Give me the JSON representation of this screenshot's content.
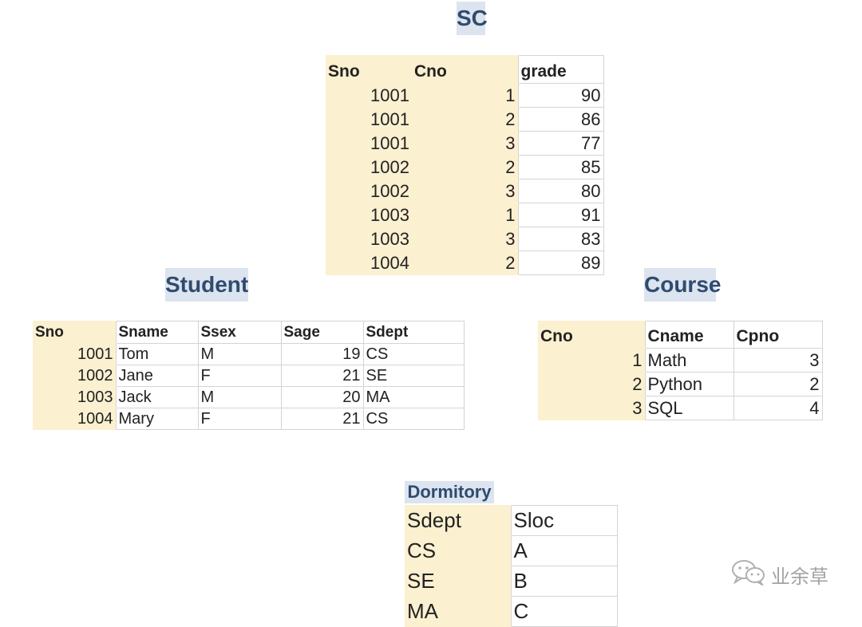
{
  "sc": {
    "title": "SC",
    "columns": [
      "Sno",
      "Cno",
      "grade"
    ],
    "rows": [
      [
        "1001",
        "1",
        "90"
      ],
      [
        "1001",
        "2",
        "86"
      ],
      [
        "1001",
        "3",
        "77"
      ],
      [
        "1002",
        "2",
        "85"
      ],
      [
        "1002",
        "3",
        "80"
      ],
      [
        "1003",
        "1",
        "91"
      ],
      [
        "1003",
        "3",
        "83"
      ],
      [
        "1004",
        "2",
        "89"
      ]
    ]
  },
  "student": {
    "title": "Student",
    "columns": [
      "Sno",
      "Sname",
      "Ssex",
      "Sage",
      "Sdept"
    ],
    "rows": [
      [
        "1001",
        "Tom",
        "M",
        "19",
        "CS"
      ],
      [
        "1002",
        "Jane",
        "F",
        "21",
        "SE"
      ],
      [
        "1003",
        "Jack",
        "M",
        "20",
        "MA"
      ],
      [
        "1004",
        "Mary",
        "F",
        "21",
        "CS"
      ]
    ]
  },
  "course": {
    "title": "Course",
    "columns": [
      "Cno",
      "Cname",
      "Cpno"
    ],
    "rows": [
      [
        "1",
        "Math",
        "3"
      ],
      [
        "2",
        "Python",
        "2"
      ],
      [
        "3",
        "SQL",
        "4"
      ]
    ]
  },
  "dormitory": {
    "title": "Dormitory",
    "columns": [
      "Sdept",
      "Sloc"
    ],
    "rows": [
      [
        "CS",
        "A"
      ],
      [
        "SE",
        "B"
      ],
      [
        "MA",
        "C"
      ]
    ]
  },
  "watermark": {
    "text": "业余草",
    "icon": "wechat-icon"
  },
  "colors": {
    "title_bg": "#dbe4ef",
    "title_text": "#2f4b6e",
    "key_column_bg": "#fbf0d0"
  }
}
